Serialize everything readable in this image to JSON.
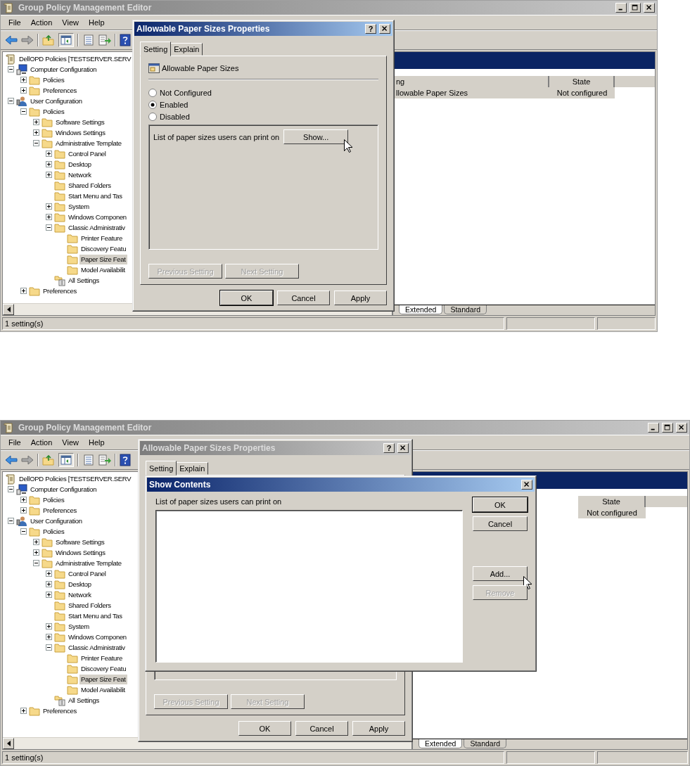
{
  "screens": [
    {
      "window": {
        "title": "Group Policy Management Editor",
        "active": false
      },
      "menu": [
        "File",
        "Action",
        "View",
        "Help"
      ],
      "tree": [
        {
          "label": "DellOPD Policies [TESTSERVER.SERV",
          "kind": "policy",
          "selected": false,
          "children": [
            {
              "label": "Computer Configuration",
              "kind": "computer",
              "expanded": true,
              "selected": false,
              "children": [
                {
                  "label": "Policies",
                  "kind": "folder",
                  "expanded": false,
                  "selected": false
                },
                {
                  "label": "Preferences",
                  "kind": "folder",
                  "expanded": false,
                  "selected": false
                }
              ]
            },
            {
              "label": "User Configuration",
              "kind": "user",
              "expanded": true,
              "selected": false,
              "children": [
                {
                  "label": "Policies",
                  "kind": "folder",
                  "expanded": true,
                  "selected": false,
                  "children": [
                    {
                      "label": "Software Settings",
                      "kind": "folder",
                      "expanded": false,
                      "selected": false
                    },
                    {
                      "label": "Windows Settings",
                      "kind": "folder",
                      "expanded": false,
                      "selected": false
                    },
                    {
                      "label": "Administrative Template",
                      "kind": "folder",
                      "expanded": true,
                      "selected": false,
                      "children": [
                        {
                          "label": "Control Panel",
                          "kind": "folder",
                          "expanded": false,
                          "selected": false
                        },
                        {
                          "label": "Desktop",
                          "kind": "folder",
                          "expanded": false,
                          "selected": false
                        },
                        {
                          "label": "Network",
                          "kind": "folder",
                          "expanded": false,
                          "selected": false
                        },
                        {
                          "label": "Shared Folders",
                          "kind": "folder",
                          "selected": false
                        },
                        {
                          "label": "Start Menu and Tas",
                          "kind": "folder",
                          "selected": false
                        },
                        {
                          "label": "System",
                          "kind": "folder",
                          "expanded": false,
                          "selected": false
                        },
                        {
                          "label": "Windows Componen",
                          "kind": "folder",
                          "expanded": false,
                          "selected": false
                        },
                        {
                          "label": "Classic Administrativ",
                          "kind": "folder",
                          "expanded": true,
                          "selected": false,
                          "children": [
                            {
                              "label": "Printer Feature",
                              "kind": "folder",
                              "selected": false
                            },
                            {
                              "label": "Discovery Featu",
                              "kind": "folder",
                              "selected": false
                            },
                            {
                              "label": "Paper Size Feat",
                              "kind": "folder",
                              "selected": true
                            },
                            {
                              "label": "Model Availabilit",
                              "kind": "folder",
                              "selected": false
                            }
                          ]
                        },
                        {
                          "label": "All Settings",
                          "kind": "settings",
                          "selected": false
                        }
                      ]
                    }
                  ]
                },
                {
                  "label": "Preferences",
                  "kind": "folder",
                  "expanded": false,
                  "selected": false
                }
              ]
            }
          ]
        }
      ],
      "details": {
        "columns": [
          "ng",
          "State"
        ],
        "rows": [
          {
            "cells": [
              "llowable Paper Sizes",
              "Not configured"
            ],
            "selected": true
          }
        ]
      },
      "view_tabs": [
        {
          "label": "Extended",
          "selected": true
        },
        {
          "label": "Standard",
          "selected": false
        }
      ],
      "status_bar": [
        "1 setting(s)"
      ],
      "dialogs": [
        {
          "kind": "properties",
          "title": "Allowable Paper Sizes Properties",
          "active": true,
          "help_button": "?",
          "tabs": [
            {
              "label": "Setting",
              "selected": true
            },
            {
              "label": "Explain",
              "selected": false
            }
          ],
          "policy_name": "Allowable Paper Sizes",
          "options": [
            {
              "label": "Not Configured",
              "selected": false
            },
            {
              "label": "Enabled",
              "selected": true
            },
            {
              "label": "Disabled",
              "selected": false
            }
          ],
          "option_label": "List of paper sizes users can print on",
          "show_button": "Show...",
          "nav_buttons": [
            {
              "label": "Previous Setting",
              "disabled": true
            },
            {
              "label": "Next Setting",
              "disabled": true
            }
          ],
          "buttons": [
            {
              "label": "OK",
              "default": true,
              "disabled": false
            },
            {
              "label": "Cancel",
              "default": false,
              "disabled": false
            },
            {
              "label": "Apply",
              "default": false,
              "disabled": false
            }
          ]
        }
      ]
    },
    {
      "window": {
        "title": "Group Policy Management Editor",
        "active": false
      },
      "menu": [
        "File",
        "Action",
        "View",
        "Help"
      ],
      "tree": [
        {
          "label": "DellOPD Policies [TESTSERVER.SERV",
          "kind": "policy",
          "selected": false,
          "children": [
            {
              "label": "Computer Configuration",
              "kind": "computer",
              "expanded": true,
              "selected": false,
              "children": [
                {
                  "label": "Policies",
                  "kind": "folder",
                  "expanded": false,
                  "selected": false
                },
                {
                  "label": "Preferences",
                  "kind": "folder",
                  "expanded": false,
                  "selected": false
                }
              ]
            },
            {
              "label": "User Configuration",
              "kind": "user",
              "expanded": true,
              "selected": false,
              "children": [
                {
                  "label": "Policies",
                  "kind": "folder",
                  "expanded": true,
                  "selected": false,
                  "children": [
                    {
                      "label": "Software Settings",
                      "kind": "folder",
                      "expanded": false,
                      "selected": false
                    },
                    {
                      "label": "Windows Settings",
                      "kind": "folder",
                      "expanded": false,
                      "selected": false
                    },
                    {
                      "label": "Administrative Template",
                      "kind": "folder",
                      "expanded": true,
                      "selected": false,
                      "children": [
                        {
                          "label": "Control Panel",
                          "kind": "folder",
                          "expanded": false,
                          "selected": false
                        },
                        {
                          "label": "Desktop",
                          "kind": "folder",
                          "expanded": false,
                          "selected": false
                        },
                        {
                          "label": "Network",
                          "kind": "folder",
                          "expanded": false,
                          "selected": false
                        },
                        {
                          "label": "Shared Folders",
                          "kind": "folder",
                          "selected": false
                        },
                        {
                          "label": "Start Menu and Tas",
                          "kind": "folder",
                          "selected": false
                        },
                        {
                          "label": "System",
                          "kind": "folder",
                          "expanded": false,
                          "selected": false
                        },
                        {
                          "label": "Windows Componen",
                          "kind": "folder",
                          "expanded": false,
                          "selected": false
                        },
                        {
                          "label": "Classic Administrativ",
                          "kind": "folder",
                          "expanded": true,
                          "selected": false,
                          "children": [
                            {
                              "label": "Printer Feature",
                              "kind": "folder",
                              "selected": false
                            },
                            {
                              "label": "Discovery Featu",
                              "kind": "folder",
                              "selected": false
                            },
                            {
                              "label": "Paper Size Feat",
                              "kind": "folder",
                              "selected": true
                            },
                            {
                              "label": "Model Availabilit",
                              "kind": "folder",
                              "selected": false
                            }
                          ]
                        },
                        {
                          "label": "All Settings",
                          "kind": "settings",
                          "selected": false
                        }
                      ]
                    }
                  ]
                },
                {
                  "label": "Preferences",
                  "kind": "folder",
                  "expanded": false,
                  "selected": false
                }
              ]
            }
          ]
        }
      ],
      "details": {
        "columns": [
          "State"
        ],
        "rows": [
          {
            "cells": [
              "Not configured"
            ],
            "selected": true
          }
        ]
      },
      "view_tabs": [
        {
          "label": "Extended",
          "selected": true
        },
        {
          "label": "Standard",
          "selected": false
        }
      ],
      "status_bar": [
        "1 setting(s)"
      ],
      "dialogs": [
        {
          "kind": "properties",
          "title": "Allowable Paper Sizes Properties",
          "active": false,
          "help_button": "?",
          "tabs": [
            {
              "label": "Setting",
              "selected": true
            },
            {
              "label": "Explain",
              "selected": false
            }
          ],
          "nav_buttons": [
            {
              "label": "Previous Setting",
              "disabled": true
            },
            {
              "label": "Next Setting",
              "disabled": true
            }
          ],
          "buttons": [
            {
              "label": "OK",
              "default": false,
              "disabled": false
            },
            {
              "label": "Cancel",
              "default": false,
              "disabled": false
            },
            {
              "label": "Apply",
              "default": false,
              "disabled": false
            }
          ]
        },
        {
          "kind": "show_contents",
          "title": "Show Contents",
          "active": true,
          "label": "List of paper sizes users can print on",
          "buttons": [
            {
              "label": "OK",
              "default": true,
              "disabled": false
            },
            {
              "label": "Cancel",
              "default": false,
              "disabled": false
            },
            {
              "label": "Add...",
              "default": false,
              "disabled": false
            },
            {
              "label": "Remove",
              "default": false,
              "disabled": true
            }
          ]
        }
      ]
    }
  ]
}
